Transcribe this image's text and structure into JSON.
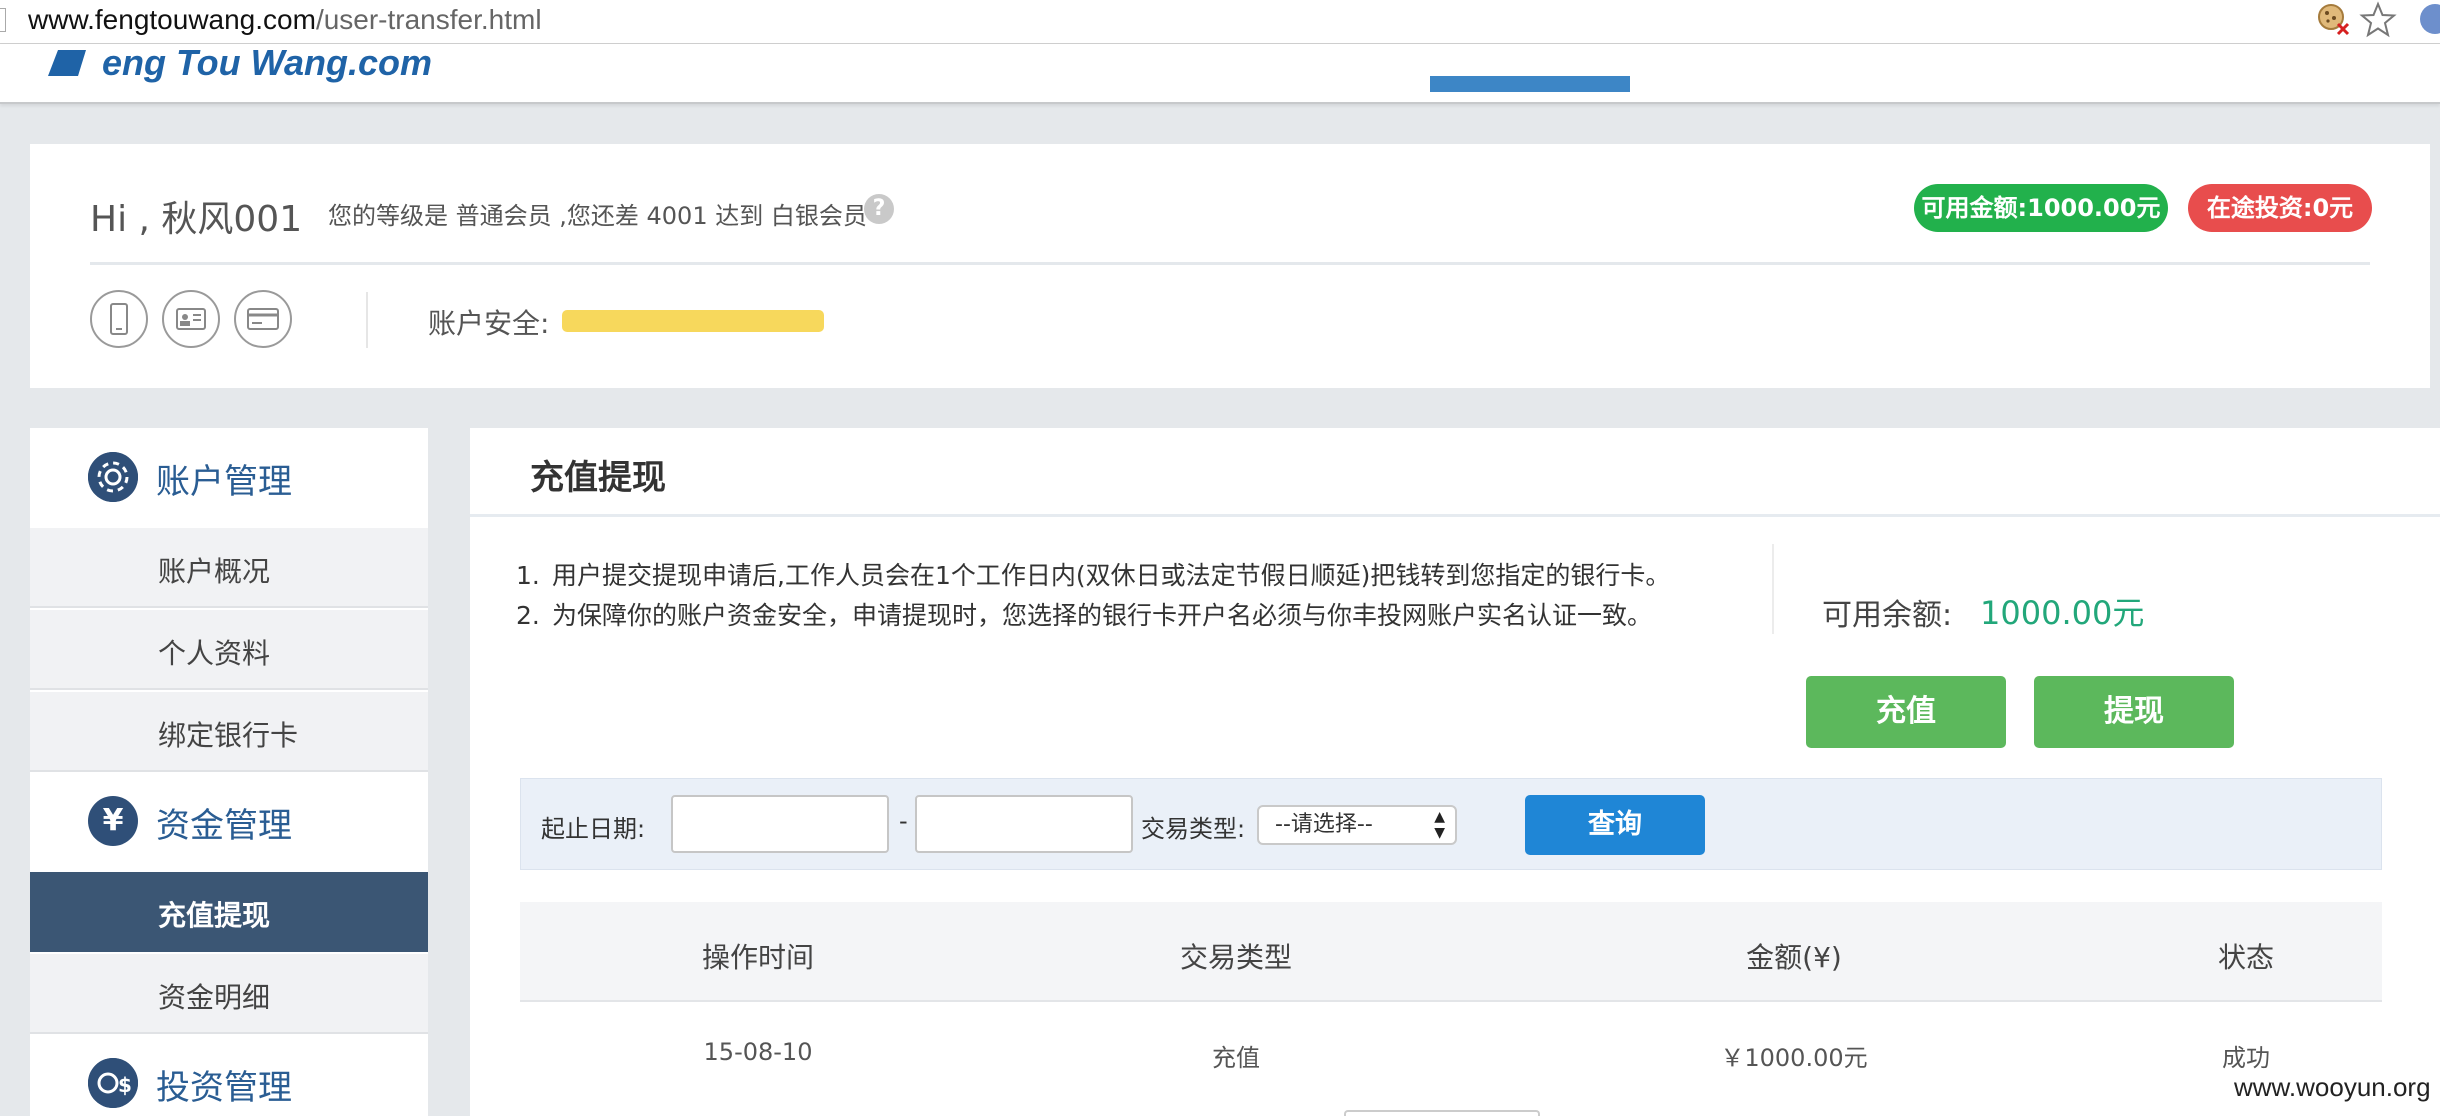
{
  "browser": {
    "url_host": "www.fengtouwang.com",
    "url_path": "/user-transfer.html"
  },
  "site": {
    "logo_text": "eng Tou Wang.com"
  },
  "user_panel": {
    "greeting": "Hi , 秋风001",
    "level_text": "您的等级是 普通会员 ,您还差 4001 达到 白银会员",
    "help_glyph": "?",
    "available_badge": "可用金额:1000.00元",
    "investing_badge": "在途投资:0元",
    "security_label": "账户安全:",
    "colors": {
      "available": "#22b14c",
      "investing": "#e84d4d",
      "security_bar": "#f7d85c"
    }
  },
  "sidebar": {
    "groups": [
      {
        "label": "账户管理",
        "icon": "gear-icon",
        "glyph": "⚙"
      },
      {
        "label": "资金管理",
        "icon": "yen-icon",
        "glyph": "¥"
      },
      {
        "label": "投资管理",
        "icon": "invest-icon",
        "glyph": "$"
      }
    ],
    "items": [
      {
        "label": "账户概况"
      },
      {
        "label": "个人资料"
      },
      {
        "label": "绑定银行卡"
      },
      {
        "label": "充值提现",
        "active": true
      },
      {
        "label": "资金明细"
      }
    ],
    "colors": {
      "active_bg": "#3b5674",
      "group_text": "#2a5d93"
    }
  },
  "main": {
    "title": "充值提现",
    "notices": [
      {
        "num": "1.",
        "text": "用户提交提现申请后,工作人员会在1个工作日内(双休日或法定节假日顺延)把钱转到您指定的银行卡。"
      },
      {
        "num": "2.",
        "text": "为保障你的账户资金安全，申请提现时，您选择的银行卡开户名必须与你丰投网账户实名认证一致。"
      }
    ],
    "balance_label": "可用余额:",
    "balance_value": "1000.00元",
    "recharge_button": "充值",
    "withdraw_button": "提现",
    "filter": {
      "date_label": "起止日期:",
      "date_sep": "-",
      "start_value": "",
      "end_value": "",
      "type_label": "交易类型:",
      "type_selected": "--请选择--",
      "query_button": "查询"
    },
    "table": {
      "headers": [
        "操作时间",
        "交易类型",
        "金额(¥)",
        "状态"
      ],
      "rows": [
        [
          "15-08-10",
          "充值",
          "￥1000.00元",
          "成功"
        ]
      ]
    },
    "colors": {
      "action_green": "#5cb85c",
      "query_blue": "#1f86d6",
      "balance_green": "#22a77a"
    }
  },
  "watermark": "www.wooyun.org"
}
